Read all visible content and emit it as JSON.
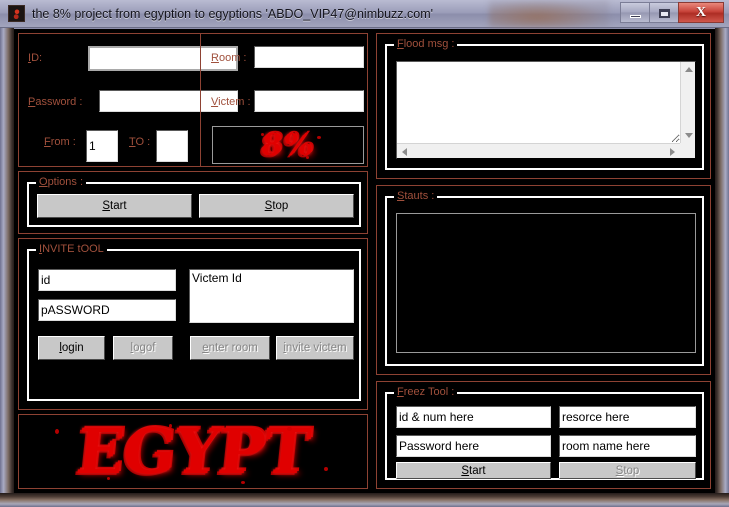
{
  "window": {
    "title": "the 8% project from egyption to egyptions 'ABDO_VIP47@nimbuzz.com'",
    "icon": "app-icon",
    "minimize_label": "–",
    "maximize_label": "□",
    "close_label": "X",
    "colors": {
      "panel_border": "#8e4233",
      "label_text": "#a0503c",
      "group_border": "#ffffff",
      "client_bg": "#000000",
      "accent_red": "#e00000",
      "button_face": "#c8c8c8",
      "disabled_text": "#868686"
    }
  },
  "login_panel": {
    "id": {
      "label": "ID:",
      "accel": "I",
      "value": "",
      "placeholder": ""
    },
    "password": {
      "label": "Password :",
      "accel": "P",
      "value": "",
      "placeholder": ""
    },
    "from": {
      "label": "From :",
      "accel": "F",
      "value": "1",
      "placeholder": ""
    },
    "to": {
      "label": "TO :",
      "accel": "T",
      "value": "",
      "placeholder": ""
    },
    "room": {
      "label": "Room :",
      "accel": "R",
      "value": "",
      "placeholder": ""
    },
    "victem": {
      "label": "Victem :",
      "accel": "V",
      "value": "",
      "placeholder": ""
    },
    "logo_text": "8%"
  },
  "options_group": {
    "title": "Options :",
    "start_label": "Start",
    "stop_label": "Stop"
  },
  "invite_group": {
    "title": "INVITE tOOL",
    "id_value": "id",
    "password_value": "pASSWORD",
    "victem_value": "Victem Id",
    "buttons": [
      {
        "label": "login",
        "disabled": false
      },
      {
        "label": "logof",
        "disabled": true
      },
      {
        "label": "enter room",
        "disabled": true
      },
      {
        "label": "invite victem",
        "disabled": true
      }
    ]
  },
  "egypt_logo": {
    "text": "EGYPT"
  },
  "flood_group": {
    "title": "Flood msg :",
    "message_value": "",
    "scroll_up": "▲",
    "scroll_down": "▼",
    "scroll_left": "◄",
    "scroll_right": "►"
  },
  "status_group": {
    "title": "Stauts :",
    "entries": []
  },
  "freez_group": {
    "title": "Freez Tool :",
    "id_num_value": "id & num here",
    "resorce_value": "resorce here",
    "password_value": "Password here",
    "room_name_value": "room name here",
    "start_label": "Start",
    "stop_label": "Stop"
  }
}
